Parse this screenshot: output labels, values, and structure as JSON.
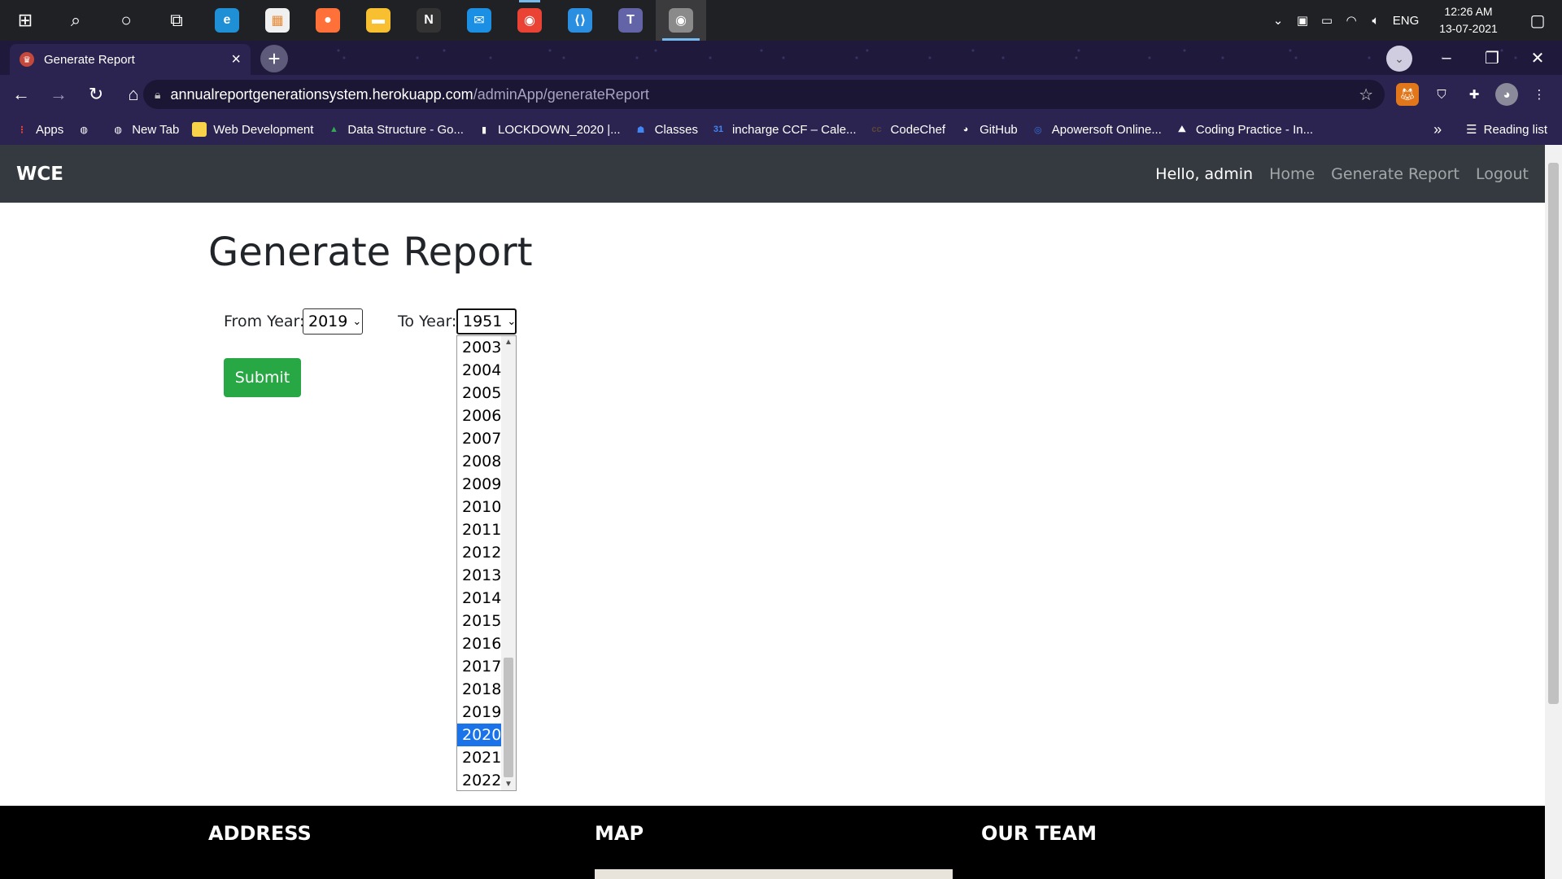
{
  "taskbar": {
    "apps": [
      {
        "name": "start",
        "glyph": "⊞"
      },
      {
        "name": "search",
        "glyph": "⌕"
      },
      {
        "name": "cortana",
        "glyph": "○"
      },
      {
        "name": "task-view",
        "glyph": "⧉"
      },
      {
        "name": "edge",
        "glyph": "e",
        "color": "#1f8fd6"
      },
      {
        "name": "store",
        "glyph": "▦",
        "color": "#f0f0f0"
      },
      {
        "name": "firefox",
        "glyph": "●",
        "color": "#ff7139"
      },
      {
        "name": "file-explorer",
        "glyph": "▬",
        "color": "#f8c030"
      },
      {
        "name": "notion",
        "glyph": "N",
        "color": "#333333"
      },
      {
        "name": "mail",
        "glyph": "✉",
        "color": "#1a8fe3"
      },
      {
        "name": "chrome",
        "glyph": "◉",
        "color": "#ea4335"
      },
      {
        "name": "vscode",
        "glyph": "⟨⟩",
        "color": "#2a8fe0"
      },
      {
        "name": "teams",
        "glyph": "T",
        "color": "#6264a7"
      },
      {
        "name": "chrome-active",
        "glyph": "◉",
        "color": "#8a8a8a"
      }
    ],
    "tray_language": "ENG",
    "time": "12:26 AM",
    "date": "13-07-2021"
  },
  "browser": {
    "tab_title": "Generate Report",
    "url_host": "annualreportgenerationsystem.herokuapp.com",
    "url_path": "/adminApp/generateReport",
    "bookmarks": [
      {
        "label": "Apps",
        "color": "#ea4335",
        "glyph": "⋮"
      },
      {
        "label": "",
        "color": "#ffffff",
        "glyph": "◍"
      },
      {
        "label": "New Tab",
        "color": "#ffffff",
        "glyph": "◍"
      },
      {
        "label": "Web Development",
        "color": "#f8d34a",
        "glyph": ""
      },
      {
        "label": "Data Structure - Go...",
        "color": "#34a853",
        "glyph": "▲"
      },
      {
        "label": "LOCKDOWN_2020 |...",
        "color": "#ffffff",
        "glyph": "▮"
      },
      {
        "label": "Classes",
        "color": "#4285f4",
        "glyph": "☗"
      },
      {
        "label": "incharge CCF – Cale...",
        "color": "#4285f4",
        "glyph": "31"
      },
      {
        "label": "CodeChef",
        "color": "#5b4638",
        "glyph": "cc"
      },
      {
        "label": "GitHub",
        "color": "#ffffff",
        "glyph": "◕"
      },
      {
        "label": "Apowersoft Online...",
        "color": "#3a6fd8",
        "glyph": "◎"
      },
      {
        "label": "Coding Practice - In...",
        "color": "#ffffff",
        "glyph": "⛰"
      }
    ],
    "bookmarks_more": "»",
    "reading_list": "Reading list"
  },
  "page": {
    "brand": "WCE",
    "nav": {
      "hello": "Hello, admin",
      "home": "Home",
      "generate": "Generate Report",
      "logout": "Logout"
    },
    "title": "Generate Report",
    "from_label": "From Year:",
    "from_value": "2019",
    "to_label": "To Year:",
    "to_value": "1951",
    "submit": "Submit",
    "options": [
      "2003",
      "2004",
      "2005",
      "2006",
      "2007",
      "2008",
      "2009",
      "2010",
      "2011",
      "2012",
      "2013",
      "2014",
      "2015",
      "2016",
      "2017",
      "2018",
      "2019",
      "2020",
      "2021",
      "2022"
    ],
    "highlighted_option": "2020",
    "scroll_thumb_fraction": 0.28,
    "footer": {
      "address": "ADDRESS",
      "map": "MAP",
      "team": "OUR TEAM"
    }
  }
}
